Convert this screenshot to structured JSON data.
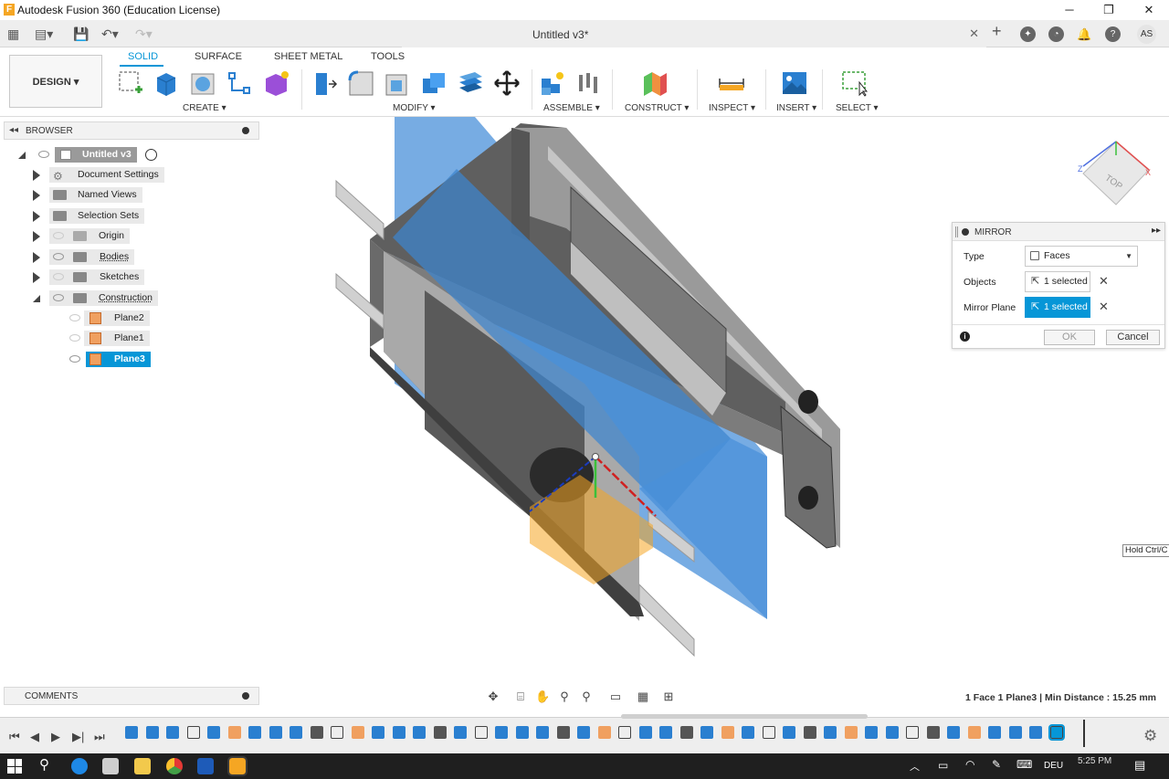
{
  "window": {
    "title": "Autodesk Fusion 360 (Education License)",
    "minimize": "─",
    "restore": "❐",
    "close": "✕"
  },
  "document": {
    "tab_title": "Untitled v3*",
    "user_initials": "AS"
  },
  "ribbon": {
    "workspace": "DESIGN ▾",
    "tabs": [
      "SOLID",
      "SURFACE",
      "SHEET METAL",
      "TOOLS"
    ],
    "active_tab": "SOLID",
    "groups": [
      "CREATE ▾",
      "MODIFY ▾",
      "ASSEMBLE ▾",
      "CONSTRUCT ▾",
      "INSPECT ▾",
      "INSERT ▾",
      "SELECT ▾"
    ]
  },
  "browser": {
    "title": "BROWSER",
    "root": "Untitled v3",
    "items": [
      {
        "label": "Document Settings"
      },
      {
        "label": "Named Views"
      },
      {
        "label": "Selection Sets"
      },
      {
        "label": "Origin"
      },
      {
        "label": "Bodies"
      },
      {
        "label": "Sketches"
      },
      {
        "label": "Construction"
      }
    ],
    "construction_children": [
      {
        "label": "Plane2"
      },
      {
        "label": "Plane1"
      },
      {
        "label": "Plane3"
      }
    ]
  },
  "mirror": {
    "title": "MIRROR",
    "type_label": "Type",
    "type_value": "Faces",
    "objects_label": "Objects",
    "objects_value": "1 selected",
    "plane_label": "Mirror Plane",
    "plane_value": "1 selected",
    "ok": "OK",
    "cancel": "Cancel"
  },
  "viewcube": {
    "face": "TOP",
    "axis_x": "X",
    "axis_z": "Z"
  },
  "comments": {
    "title": "COMMENTS"
  },
  "status": {
    "measure": "1 Face 1 Plane3 | Min Distance : 15.25 mm",
    "hint": "Hold Ctrl/C"
  },
  "taskbar": {
    "lang": "DEU",
    "time": "5:25 PM"
  },
  "colors": {
    "accent": "#0696d7",
    "plane_blue": "#4a90d9",
    "body_grey": "#8f8f8f"
  }
}
